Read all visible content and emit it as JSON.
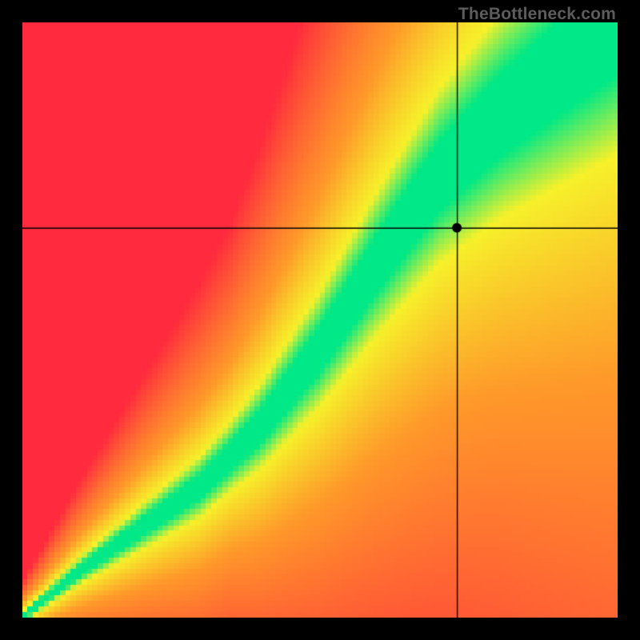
{
  "watermark": "TheBottleneck.com",
  "chart_data": {
    "type": "heatmap",
    "title": "",
    "xlabel": "",
    "ylabel": "",
    "xlim": [
      0,
      100
    ],
    "ylim": [
      0,
      100
    ],
    "crosshair": {
      "x": 73.0,
      "y": 65.5
    },
    "marker": {
      "x": 73.0,
      "y": 65.5
    },
    "green_ridge": {
      "description": "Optimal balance curve; green band center (y as function of x)",
      "points": [
        {
          "x": 0,
          "y": 0
        },
        {
          "x": 10,
          "y": 8
        },
        {
          "x": 20,
          "y": 15
        },
        {
          "x": 30,
          "y": 22
        },
        {
          "x": 40,
          "y": 32
        },
        {
          "x": 50,
          "y": 45
        },
        {
          "x": 60,
          "y": 60
        },
        {
          "x": 70,
          "y": 74
        },
        {
          "x": 80,
          "y": 84
        },
        {
          "x": 90,
          "y": 92
        },
        {
          "x": 100,
          "y": 100
        }
      ]
    },
    "color_scale": {
      "optimal": "#00e887",
      "near": "#f7f12a",
      "mid": "#ff9a2a",
      "far": "#ff2a3e"
    }
  }
}
